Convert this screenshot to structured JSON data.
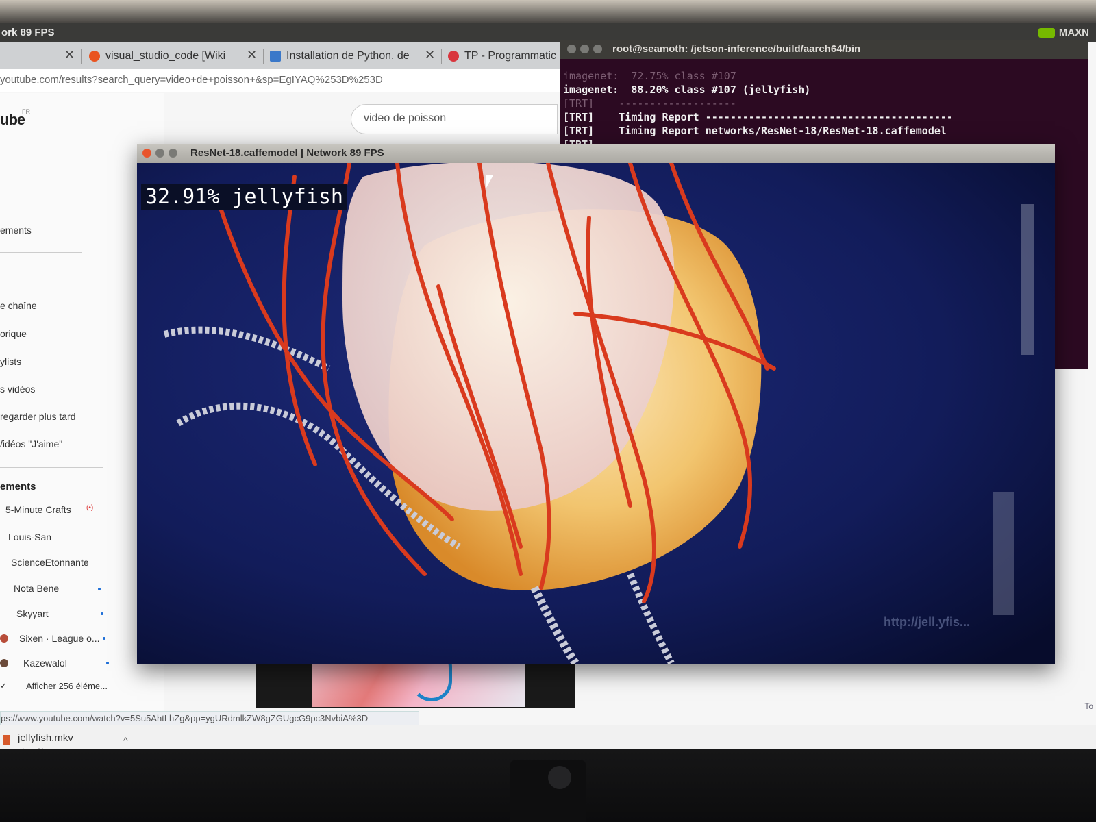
{
  "top_panel": {
    "left_text": "ork 89 FPS",
    "right_text": "MAXN",
    "colors": {
      "brand": "#76b900"
    }
  },
  "browser": {
    "tabs": [
      {
        "label": "visual_studio_code [Wiki",
        "icon": "ubuntu-icon"
      },
      {
        "label": "Installation de Python, de",
        "icon": "package-icon"
      },
      {
        "label": "TP - Programmatic",
        "icon": "tp-icon"
      }
    ],
    "url": "youtube.com/results?search_query=video+de+poisson+&sp=EgIYAQ%253D%253D",
    "search_value": "video de poisson",
    "logo_text": "ube",
    "logo_region": "FR"
  },
  "sidebar": {
    "items_top": [
      "ements"
    ],
    "items_library": [
      "e chaîne",
      "orique",
      "ylists",
      "s vidéos",
      "regarder plus tard",
      "/idéos \"J'aime\""
    ],
    "subs_heading": "ements",
    "subscriptions": [
      {
        "name": "5-Minute Crafts",
        "live": "(•)"
      },
      {
        "name": "Louis-San"
      },
      {
        "name": "ScienceEtonnante"
      },
      {
        "name": "Nota Bene"
      },
      {
        "name": "Skyyart"
      },
      {
        "name": "Sixen · League o..."
      },
      {
        "name": "Kazewalol"
      }
    ],
    "show_more": "Afficher 256 éléme..."
  },
  "status_url": "ps://www.youtube.com/watch?v=5Su5AhtLhZg&pp=ygURdmlkZW8gZGUgcG9pc3NvbiA%3D",
  "download": {
    "filename": "jellyfish.mkv",
    "status": "Annulé"
  },
  "edge_text": "To",
  "terminal": {
    "title": "root@seamoth: /jetson-inference/build/aarch64/bin",
    "lines": [
      {
        "text": "imagenet:  72.75% class #107",
        "dim": true
      },
      {
        "text": "imagenet:  88.20% class #107 (jellyfish)",
        "dim": false
      },
      {
        "text": "[TRT]    -------------------",
        "dim": true
      },
      {
        "text": "[TRT]    Timing Report ----------------------------------------",
        "dim": false
      },
      {
        "text": "[TRT]    Timing Report networks/ResNet-18/ResNet-18.caffemodel",
        "dim": false
      },
      {
        "text": "[TRT]    ----------------------------------------------",
        "dim": false
      }
    ]
  },
  "network_window": {
    "title": "ResNet-18.caffemodel | Network 89 FPS",
    "overlay": "32.91% jellyfish",
    "watermark": "http://jell.yfis..."
  }
}
